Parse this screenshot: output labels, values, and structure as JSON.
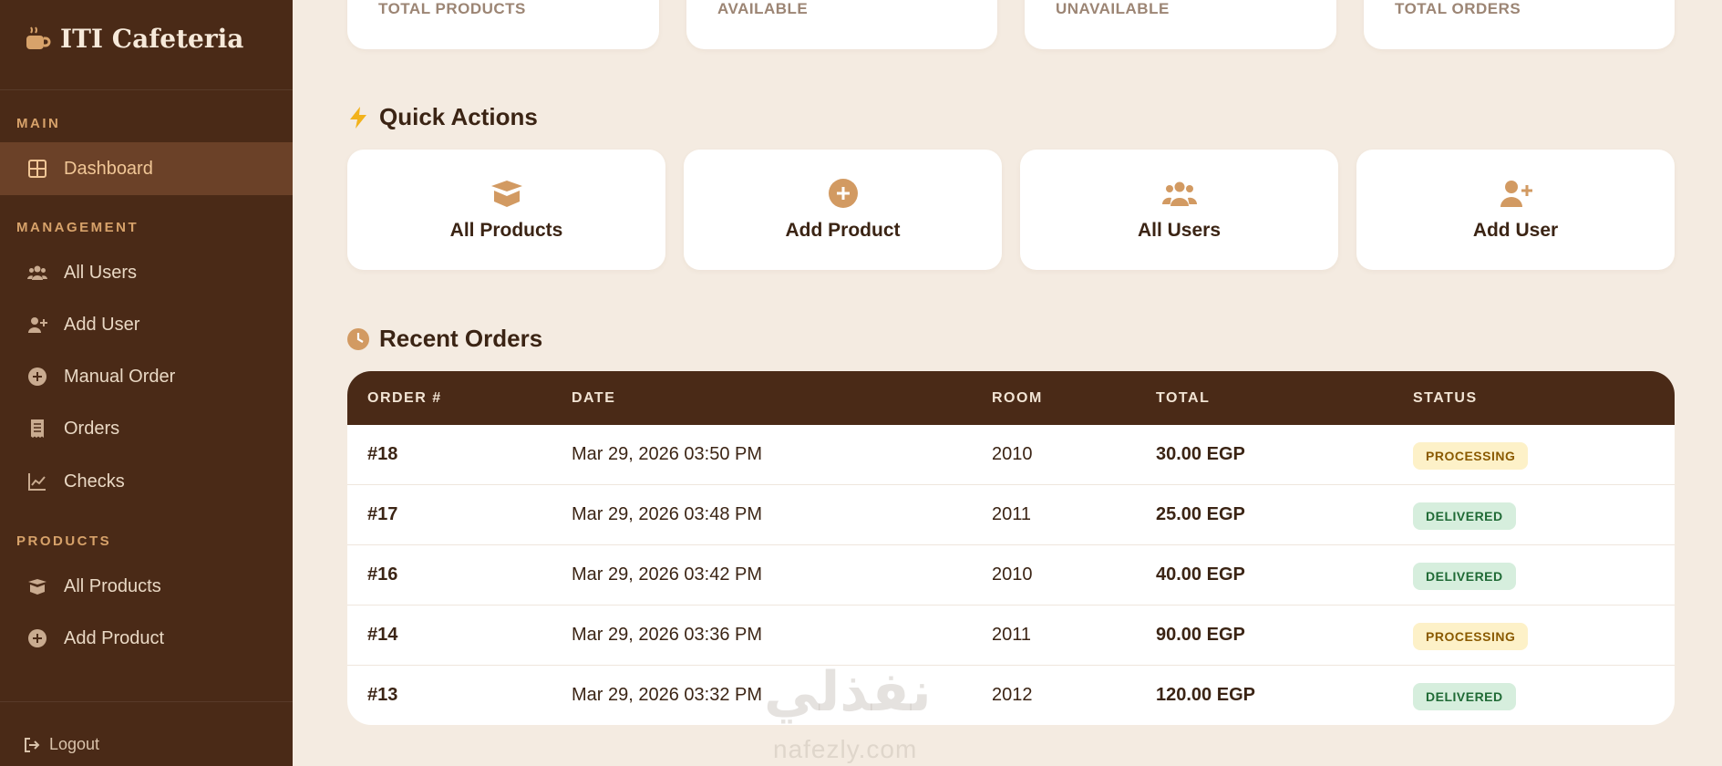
{
  "brand": {
    "name": "ITI Cafeteria"
  },
  "sidebar": {
    "sections": {
      "main": "MAIN",
      "management": "MANAGEMENT",
      "products": "PRODUCTS"
    },
    "items": {
      "dashboard": "Dashboard",
      "all_users": "All Users",
      "add_user": "Add User",
      "manual_order": "Manual Order",
      "orders": "Orders",
      "checks": "Checks",
      "all_products": "All Products",
      "add_product": "Add Product"
    },
    "logout": "Logout"
  },
  "stats": {
    "total_products": "TOTAL PRODUCTS",
    "available": "AVAILABLE",
    "unavailable": "UNAVAILABLE",
    "total_orders": "TOTAL ORDERS"
  },
  "quick_actions": {
    "heading": "Quick Actions",
    "all_products": "All Products",
    "add_product": "Add Product",
    "all_users": "All Users",
    "add_user": "Add User"
  },
  "recent_orders": {
    "heading": "Recent Orders",
    "columns": {
      "order": "ORDER #",
      "date": "DATE",
      "room": "ROOM",
      "total": "TOTAL",
      "status": "STATUS"
    },
    "rows": [
      {
        "order": "#18",
        "date": "Mar 29, 2026 03:50 PM",
        "room": "2010",
        "total": "30.00 EGP",
        "status": "PROCESSING"
      },
      {
        "order": "#17",
        "date": "Mar 29, 2026 03:48 PM",
        "room": "2011",
        "total": "25.00 EGP",
        "status": "DELIVERED"
      },
      {
        "order": "#16",
        "date": "Mar 29, 2026 03:42 PM",
        "room": "2010",
        "total": "40.00 EGP",
        "status": "DELIVERED"
      },
      {
        "order": "#14",
        "date": "Mar 29, 2026 03:36 PM",
        "room": "2011",
        "total": "90.00 EGP",
        "status": "PROCESSING"
      },
      {
        "order": "#13",
        "date": "Mar 29, 2026 03:32 PM",
        "room": "2012",
        "total": "120.00 EGP",
        "status": "DELIVERED"
      }
    ]
  },
  "watermark": {
    "arabic": "نفذلي",
    "latin": "nafezly.com"
  },
  "colors": {
    "sidebar": "#4a2a17",
    "accent": "#d7a26a",
    "background": "#f4ebe1"
  }
}
